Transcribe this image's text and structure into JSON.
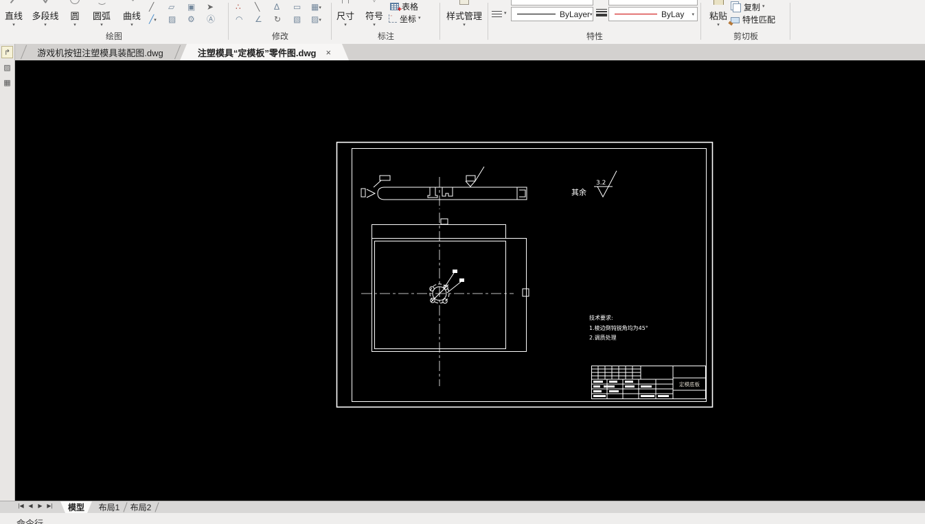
{
  "ribbon": {
    "draw": {
      "group_label": "绘图",
      "line": "直线",
      "polyline": "多段线",
      "circle": "圆",
      "arc": "圆弧",
      "spline": "曲线"
    },
    "modify": {
      "group_label": "修改"
    },
    "annotate": {
      "group_label": "标注",
      "dimension": "尺寸",
      "symbol": "符号",
      "table": "表格",
      "coordinate": "坐标"
    },
    "style_manager_label": "样式管理",
    "properties": {
      "group_label": "特性",
      "linetype_value": "ByLayer",
      "color_value": "ByLay"
    },
    "clipboard": {
      "group_label": "剪切板",
      "paste": "粘贴",
      "copy": "复制",
      "match_properties": "特性匹配"
    }
  },
  "document_tabs": {
    "tab1": "游戏机按钮注塑模具装配图.dwg",
    "tab2": "注塑模具“定模板”零件图.dwg"
  },
  "drawing": {
    "surface_prefix": "其余",
    "roughness_value": "3.2",
    "tech_notes_title": "技术要求:",
    "tech_note_1": "1.棱边倒钝锐角均为45°",
    "tech_note_2": "2.调质处理",
    "title_block_part": "定模底板"
  },
  "sheet_tabs": {
    "model": "模型",
    "layout1": "布局1",
    "layout2": "布局2"
  },
  "status": {
    "command_line": "命令行"
  },
  "colors": {
    "canvas_background": "#000000",
    "drawing_lines": "#ffffff",
    "bylayer_linetype_sample": "#000000",
    "bylayer_color_sample": "#cc0000"
  }
}
